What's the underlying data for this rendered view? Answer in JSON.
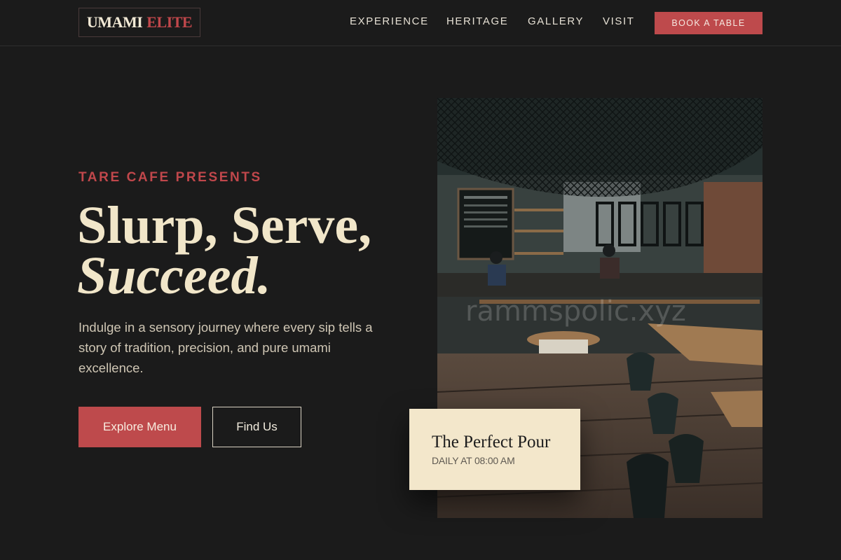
{
  "brand": {
    "name_part1": "UMAMI",
    "name_part2": "ELITE"
  },
  "nav": {
    "items": [
      {
        "label": "EXPERIENCE"
      },
      {
        "label": "HERITAGE"
      },
      {
        "label": "GALLERY"
      },
      {
        "label": "VISIT"
      }
    ],
    "cta_label": "BOOK A TABLE"
  },
  "hero": {
    "eyebrow": "TARE CAFE PRESENTS",
    "title_line1": "Slurp, Serve,",
    "title_line2": "Succeed.",
    "description": "Indulge in a sensory journey where every sip tells a story of tradition, precision, and pure umami excellence.",
    "primary_button": "Explore Menu",
    "secondary_button": "Find Us"
  },
  "feature_card": {
    "title": "The Perfect Pour",
    "subtitle": "DAILY AT 08:00 AM"
  },
  "colors": {
    "background": "#1b1b1b",
    "accent": "#be4a4c",
    "cream": "#f3e7cb",
    "text_light": "#efe6cf"
  }
}
